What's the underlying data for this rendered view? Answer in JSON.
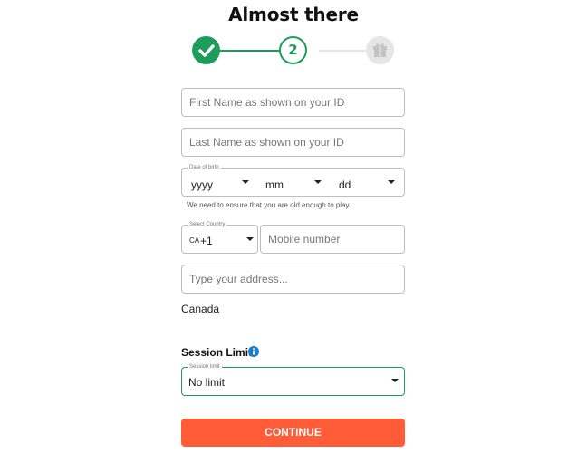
{
  "page": {
    "title": "Almost there",
    "accent_color": "#1e9c5a",
    "cta_color": "#ff5c37"
  },
  "stepper": {
    "steps": [
      {
        "state": "completed",
        "icon": "check-icon"
      },
      {
        "state": "current",
        "label": "2"
      },
      {
        "state": "pending",
        "icon": "gift-icon"
      }
    ]
  },
  "form": {
    "first_name": {
      "placeholder": "First Name as shown on your ID",
      "value": ""
    },
    "last_name": {
      "placeholder": "Last Name as shown on your ID",
      "value": ""
    },
    "dob": {
      "legend": "Date of birth",
      "year": "yyyy",
      "month": "mm",
      "day": "dd",
      "hint": "We need to ensure that you are old enough to play."
    },
    "country": {
      "legend": "Select Country",
      "code": "CA",
      "dial": "+1"
    },
    "mobile": {
      "placeholder": "Mobile number",
      "value": ""
    },
    "address": {
      "placeholder": "Type your address...",
      "value": ""
    },
    "country_name": "Canada",
    "session": {
      "heading": "Session Limit",
      "legend": "Session limit",
      "value": "No limit",
      "info_icon": "info-icon"
    },
    "continue_label": "CONTINUE"
  }
}
